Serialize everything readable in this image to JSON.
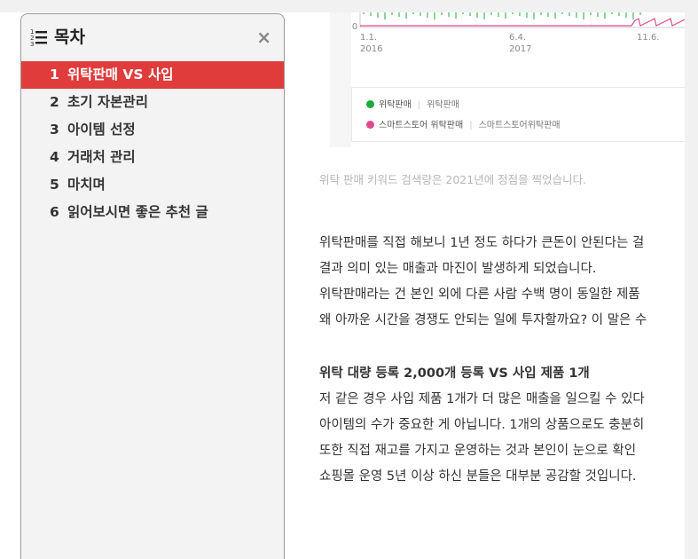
{
  "chart": {
    "y_tick": "0",
    "x_ticks": [
      {
        "line1": "1.1.",
        "line2": "2016"
      },
      {
        "line1": "6.4.",
        "line2": "2017"
      },
      {
        "line1": "11.6.",
        "line2": ""
      }
    ],
    "legend": [
      {
        "name": "위탁판매",
        "alias": "위탁판매",
        "color": "#1aab3c"
      },
      {
        "name": "스마트스토어 위탁판매",
        "alias": "스마트스토어위탁판매",
        "color": "#e0498f"
      }
    ]
  },
  "caption": "위탁 판매 키워드 검색량은 2021년에 정점을 찍었습니다.",
  "paragraph1": [
    "위탁판매를 직접 해보니 1년 정도 하다가 큰돈이 안된다는 걸",
    "결과 의미 있는 매출과 마진이 발생하게 되었습니다.",
    "위탁판매라는 건 본인 외에 다른 사람 수백 명이 동일한 제품",
    "왜 아까운 시간을 경쟁도 안되는 일에 투자할까요? 이 말은 수"
  ],
  "paragraph2_heading": "위탁 대량 등록 2,000개 등록 VS 사입 제품 1개",
  "paragraph2": [
    "저 같은 경우 사입 제품 1개가 더 많은 매출을 일으킬 수 있다",
    "아이템의 수가 중요한 게 아닙니다. 1개의 상품으로도 충분히",
    "또한 직접 재고를 가지고 운영하는 것과 본인이 눈으로 확인",
    "쇼핑몰 운영 5년 이상 하신 분들은 대부분 공감할 것입니다."
  ],
  "toc": {
    "title": "목차",
    "close": "×",
    "items": [
      {
        "num": "1",
        "label": "위탁판매 VS 사입"
      },
      {
        "num": "2",
        "label": "초기 자본관리"
      },
      {
        "num": "3",
        "label": "아이템 선정"
      },
      {
        "num": "4",
        "label": "거래처 관리"
      },
      {
        "num": "5",
        "label": "마치며"
      },
      {
        "num": "6",
        "label": "읽어보시면 좋은 추천 글"
      }
    ],
    "active_index": 0
  }
}
